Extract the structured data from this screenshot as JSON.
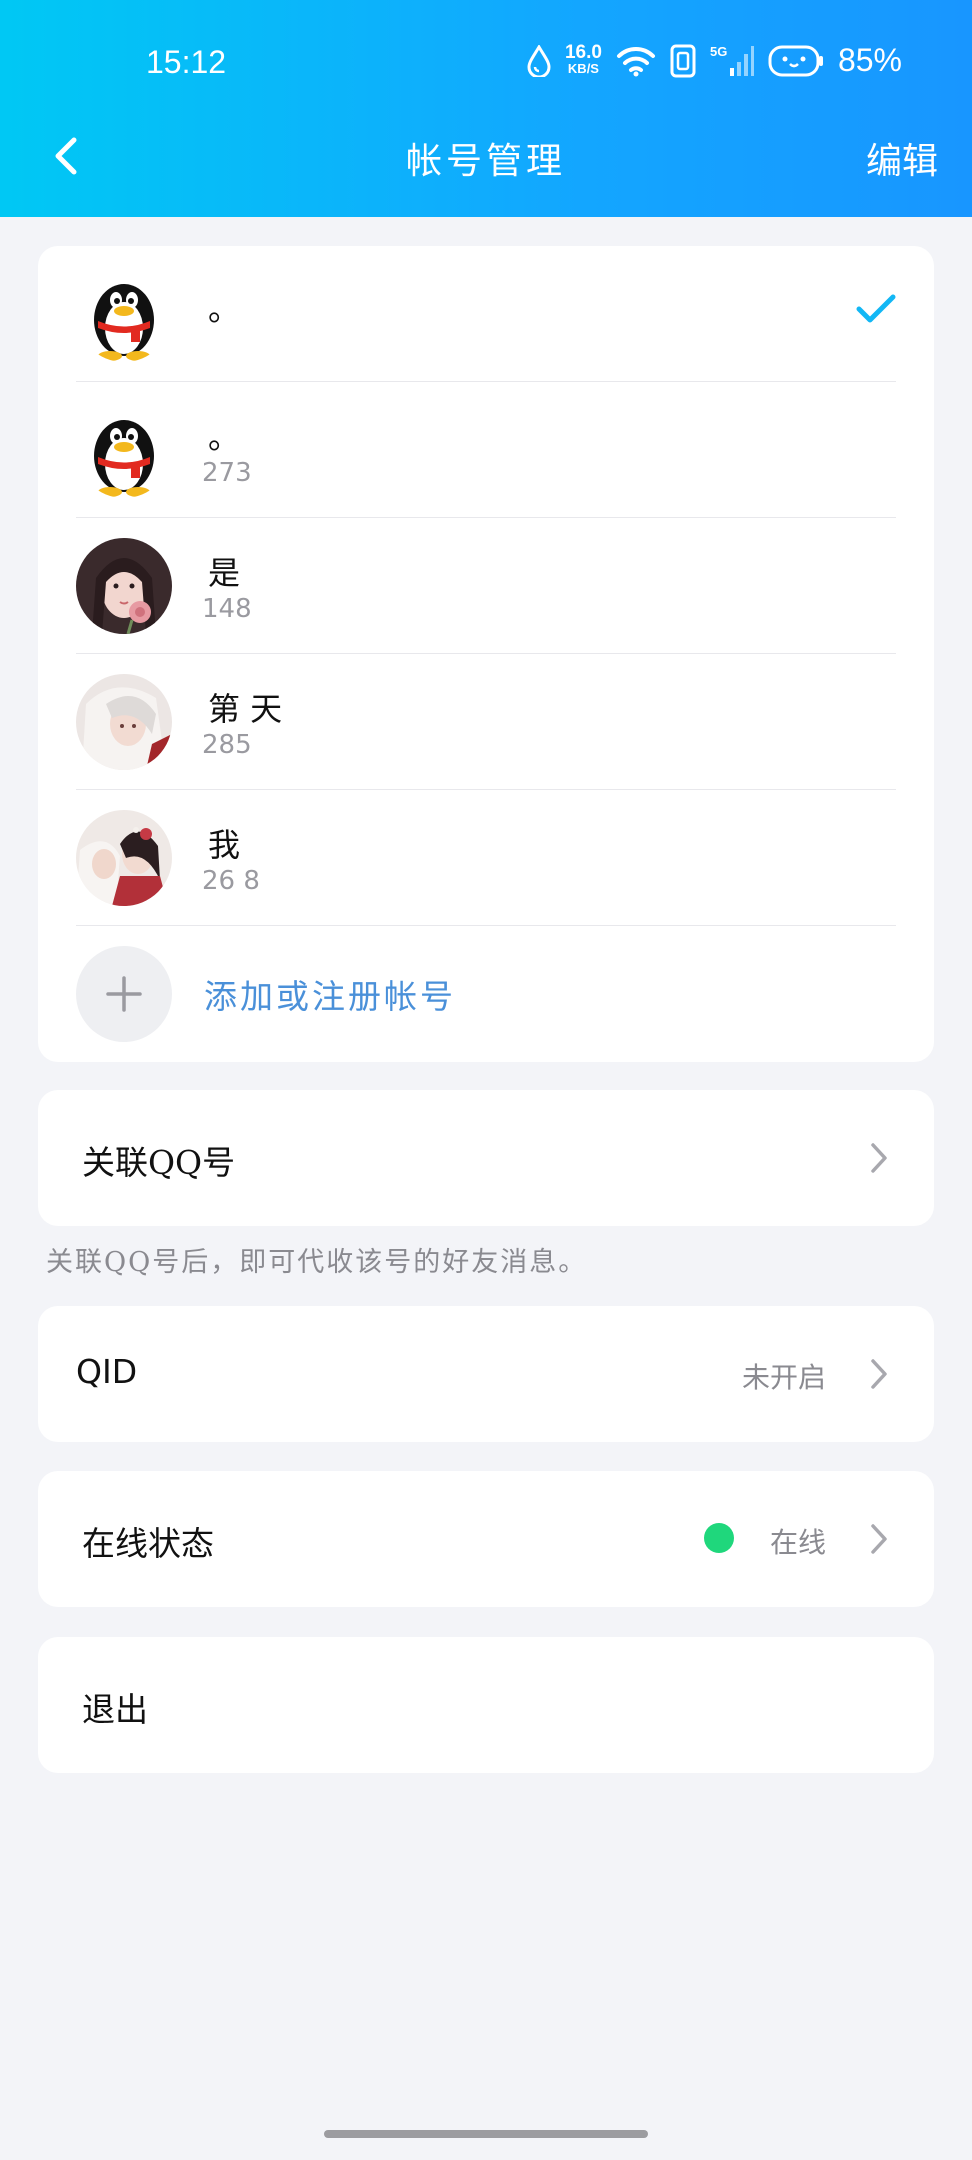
{
  "status_bar": {
    "time": "15:12",
    "net_speed": "16.0",
    "net_unit": "KB/S",
    "network_type": "5G",
    "battery": "85%"
  },
  "nav": {
    "title": "帐号管理",
    "edit": "编辑"
  },
  "accounts": [
    {
      "name": "。",
      "id": "",
      "avatar": "qq-penguin",
      "selected": true
    },
    {
      "name": "。",
      "id": "273",
      "avatar": "qq-penguin",
      "selected": false
    },
    {
      "name": "是",
      "id": "148",
      "avatar": "photo-girl-rose",
      "selected": false
    },
    {
      "name": "第 天",
      "id": "285",
      "avatar": "illustration-white-hair",
      "selected": false
    },
    {
      "name": "我",
      "id": "26 8",
      "avatar": "illustration-couple",
      "selected": false
    }
  ],
  "add_account": {
    "label": "添加或注册帐号"
  },
  "linked_qq": {
    "label": "关联QQ号",
    "hint": "关联QQ号后，即可代收该号的好友消息。"
  },
  "qid": {
    "label": "QID",
    "value": "未开启"
  },
  "online_status": {
    "label": "在线状态",
    "value": "在线",
    "color": "#1fd77c"
  },
  "logout": {
    "label": "退出"
  }
}
